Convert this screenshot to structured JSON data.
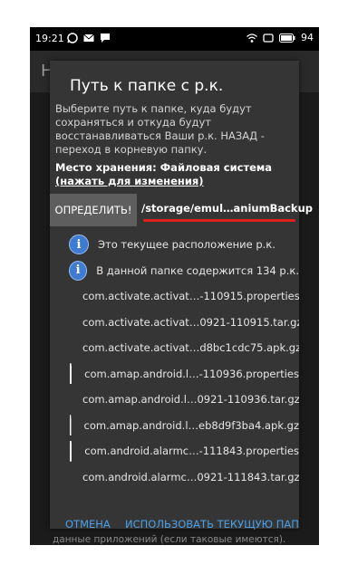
{
  "statusbar": {
    "time": "19:21",
    "battery": "94",
    "icons_left": [
      "whatsapp-icon",
      "mail-icon",
      "chat-icon"
    ],
    "icons_right": [
      "wifi-icon",
      "screen-icon",
      "battery-icon"
    ]
  },
  "background_app": {
    "title_initial": "Н",
    "footer_text": "данные приложений (если таковые имеются)."
  },
  "dialog": {
    "title": "Путь к папке с р.к.",
    "description": "Выберите путь к папке, куда будут сохраняться и откуда будут восстанавливаться Ваши р.к. НАЗАД - переход в корневую папку.",
    "storage_label": "Место хранения: Файловая система ",
    "storage_link": "(нажать для изменения)",
    "detect_button": "ОПРЕДЕЛИТЬ!",
    "path": "/storage/emul…aniumBackup",
    "info_rows": [
      "Это текущее расположение р.к.",
      "В данной папке содержится 134 р.к."
    ],
    "files": [
      "com.activate.activat…-110915.properties",
      "com.activate.activat…0921-110915.tar.gz",
      "com.activate.activat…d8bc1cdc75.apk.gz",
      "com.amap.android.l…-110936.properties",
      "com.amap.android.l…0921-110936.tar.gz",
      "com.amap.android.l…eb8d9f3ba4.apk.gz",
      "com.android.alarmc…-111843.properties",
      "com.android.alarmc…0921-111843.tar.gz"
    ],
    "cancel_button": "ОТМЕНА",
    "use_current_button": "ИСПОЛЬЗОВАТЬ ТЕКУЩУЮ ПАПКУ"
  }
}
